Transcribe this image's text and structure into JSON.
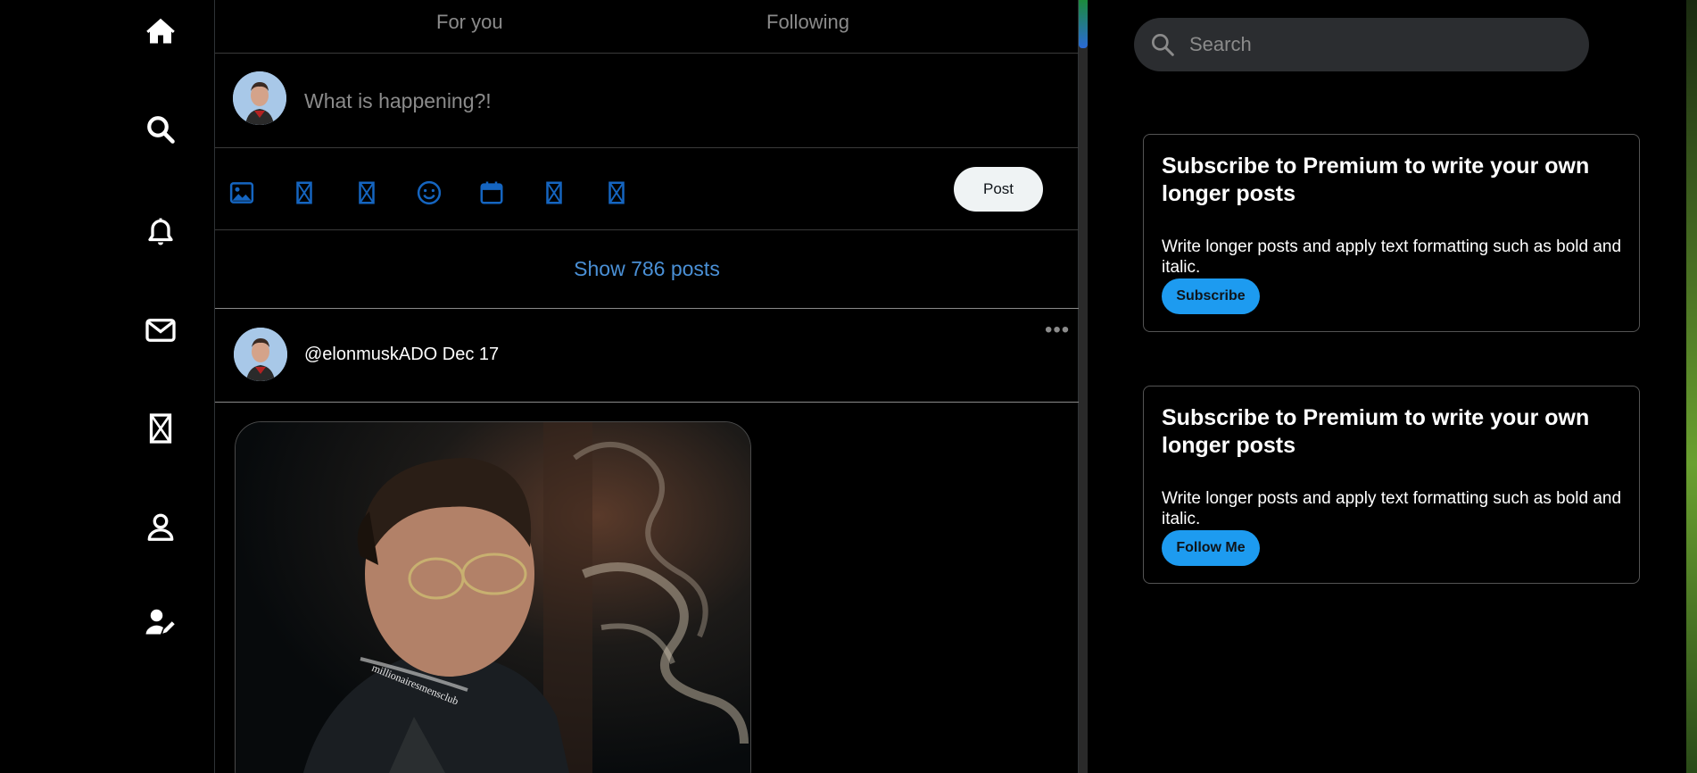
{
  "tabs": {
    "for_you": "For you",
    "following": "Following"
  },
  "composer": {
    "placeholder": "What is happening?!"
  },
  "toolbar": {
    "post_label": "Post"
  },
  "feed": {
    "show_posts": "Show 786 posts"
  },
  "post": {
    "meta": "@elonmuskADO Dec 17",
    "more": "•••",
    "image_watermark": "millionairesmensclub"
  },
  "search": {
    "placeholder": "Search"
  },
  "cards": [
    {
      "title": "Subscribe to Premium to write your own longer posts",
      "body": "Write longer posts and apply text formatting such as bold and italic.",
      "button": "Subscribe"
    },
    {
      "title": "Subscribe to Premium to write your own longer posts",
      "body": "Write longer posts and apply text formatting such as bold and italic.",
      "button": "Follow Me"
    }
  ],
  "colors": {
    "accent": "#1d9bf0",
    "icon_blue": "#1565c0",
    "link_blue": "#4a90d6"
  },
  "icons": [
    "home-icon",
    "search-icon",
    "bell-icon",
    "mail-icon",
    "broken-icon",
    "profile-icon",
    "user-edit-icon"
  ]
}
